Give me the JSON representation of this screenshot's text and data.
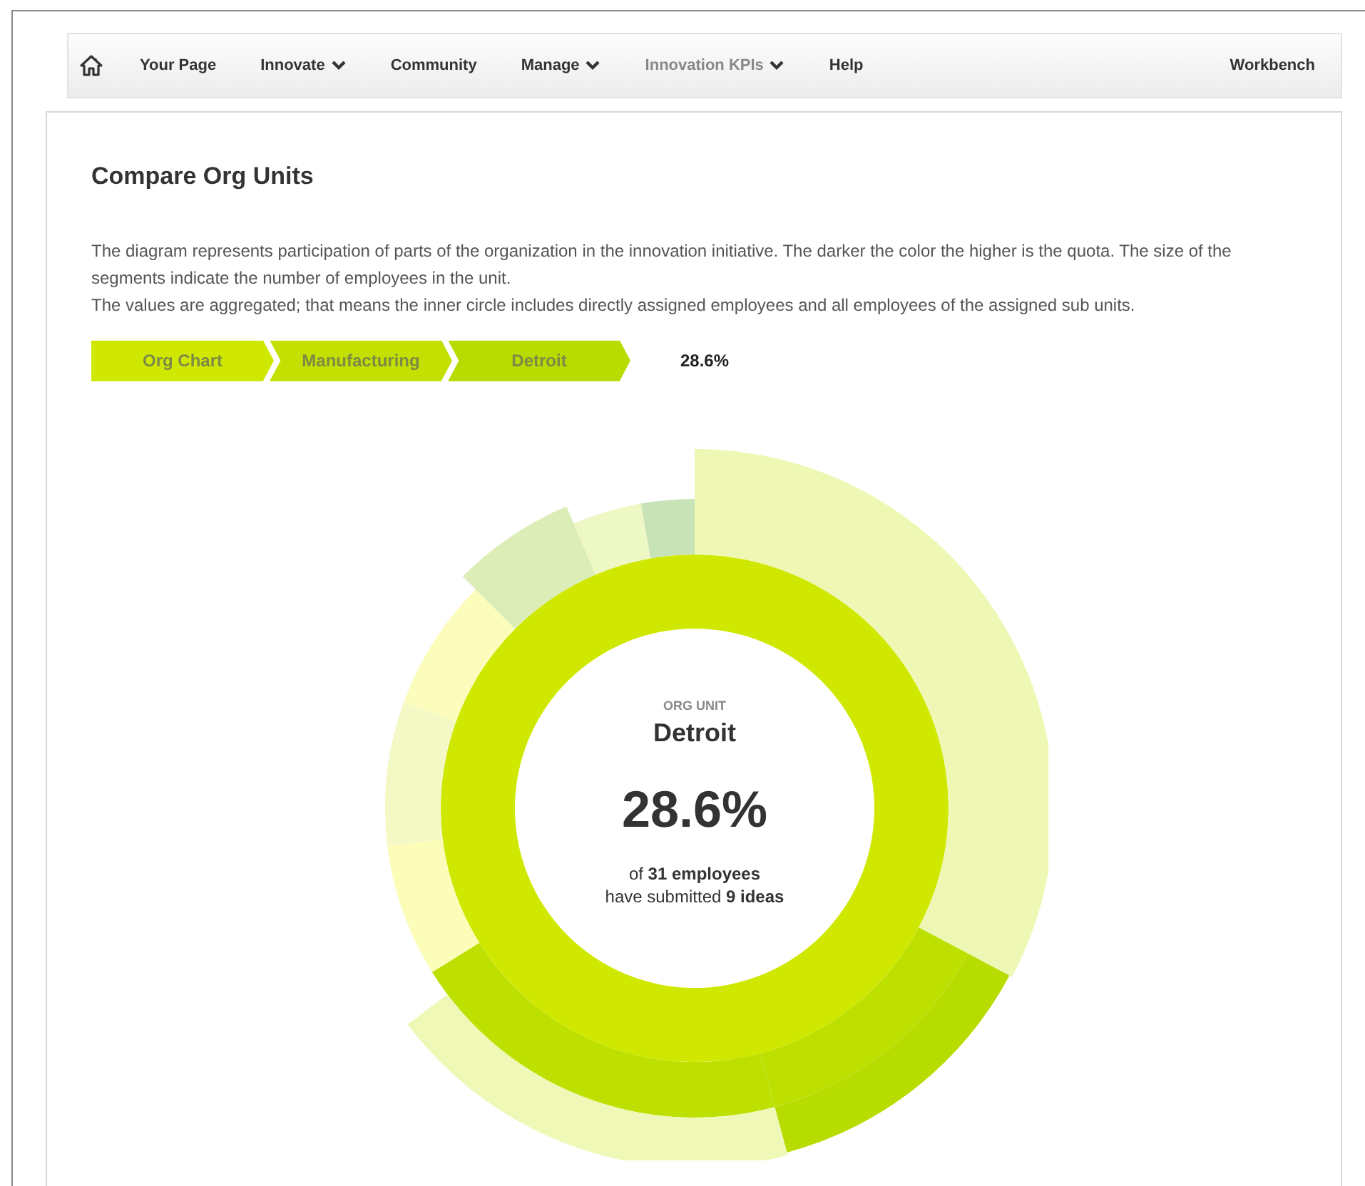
{
  "nav": {
    "items": [
      {
        "label": "Your Page",
        "dropdown": false,
        "selected": false
      },
      {
        "label": "Innovate",
        "dropdown": true,
        "selected": false
      },
      {
        "label": "Community",
        "dropdown": false,
        "selected": false
      },
      {
        "label": "Manage",
        "dropdown": true,
        "selected": false
      },
      {
        "label": "Innovation KPIs",
        "dropdown": true,
        "selected": true
      },
      {
        "label": "Help",
        "dropdown": false,
        "selected": false
      }
    ],
    "right": "Workbench"
  },
  "page": {
    "title": "Compare Org Units",
    "description": [
      "The diagram represents participation of parts of the organization in the innovation initiative. The darker the color the higher is the quota. The size of the segments indicate the number of employees in the unit.",
      "The values are aggregated; that means the inner circle includes directly assigned employees and all employees of the assigned sub units."
    ],
    "breadcrumb": [
      {
        "label": "Org Chart",
        "color": "#d0e800"
      },
      {
        "label": "Manufacturing",
        "color": "#c4e000"
      },
      {
        "label": "Detroit",
        "color": "#b8dc00"
      }
    ],
    "breadcrumb_value": "28.6%",
    "center": {
      "caption": "ORG UNIT",
      "name": "Detroit",
      "value": "28.6%",
      "lines": [
        "of **31 employees**",
        "have submitted **9 ideas**"
      ]
    }
  }
}
